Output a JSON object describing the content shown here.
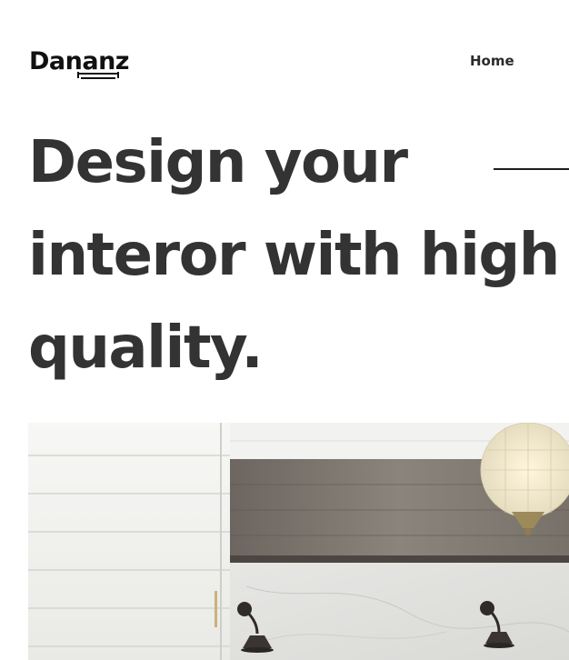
{
  "header": {
    "logo": "Dananz",
    "nav": [
      {
        "label": "Home"
      }
    ]
  },
  "hero": {
    "title_lines": [
      "Design your",
      "interor with high",
      "quality."
    ]
  },
  "colors": {
    "heading": "#333333",
    "background": "#ffffff",
    "accent_line": "#1d1d1d"
  }
}
